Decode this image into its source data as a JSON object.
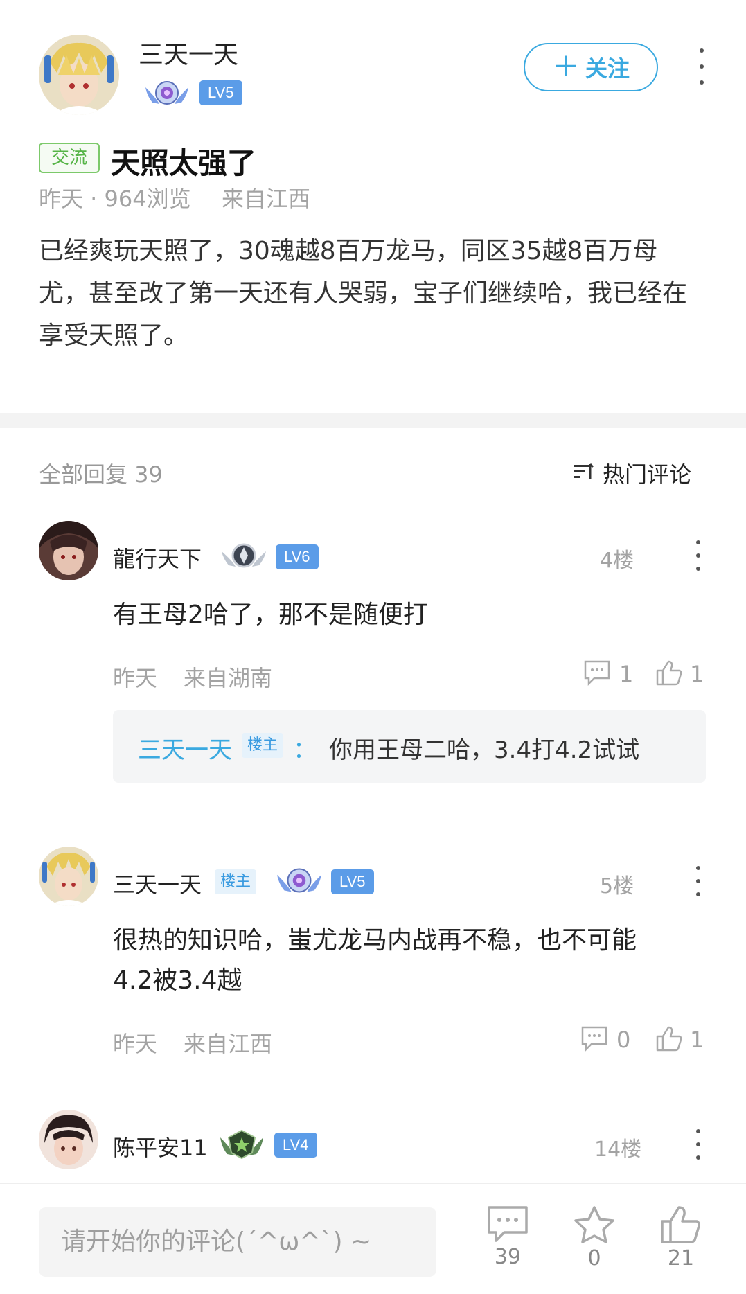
{
  "post": {
    "author": "三天一天",
    "level": "LV5",
    "follow_label": "关注",
    "tag": "交流",
    "title": "天照太强了",
    "meta_time": "昨天 · 964浏览",
    "meta_location": "来自江西",
    "body": "已经爽玩天照了，30魂越8百万龙马，同区35越8百万母尤，甚至改了第一天还有人哭弱，宝子们继续哈，我已经在享受天照了。"
  },
  "replies_header": {
    "count_label": "全部回复 39",
    "sort_label": "热门评论"
  },
  "comments": [
    {
      "author": "龍行天下",
      "level": "LV6",
      "floor": "4楼",
      "text": "有王母2哈了，那不是随便打",
      "time": "昨天",
      "location": "来自湖南",
      "reply_count": "1",
      "like_count": "1",
      "sub_reply": {
        "author": "三天一天",
        "owner_tag": "楼主",
        "separator": "：",
        "text": "你用王母二哈，3.4打4.2试试"
      }
    },
    {
      "author": "三天一天",
      "owner_tag": "楼主",
      "level": "LV5",
      "floor": "5楼",
      "text_line1": "很热的知识哈，蚩尤龙马内战再不稳，也不可能",
      "text_line2": "4.2被3.4越",
      "time": "昨天",
      "location": "来自江西",
      "reply_count": "0",
      "like_count": "1"
    },
    {
      "author": "陈平安11",
      "level": "LV4",
      "floor": "14楼"
    }
  ],
  "bottom_bar": {
    "input_placeholder": "请开始你的评论(´^ω^`) ~",
    "comment_count": "39",
    "star_count": "0",
    "like_count": "21"
  },
  "colors": {
    "accent": "#3aa9e0",
    "level_badge": "#5b9ce8",
    "tag_green": "#56b447"
  }
}
